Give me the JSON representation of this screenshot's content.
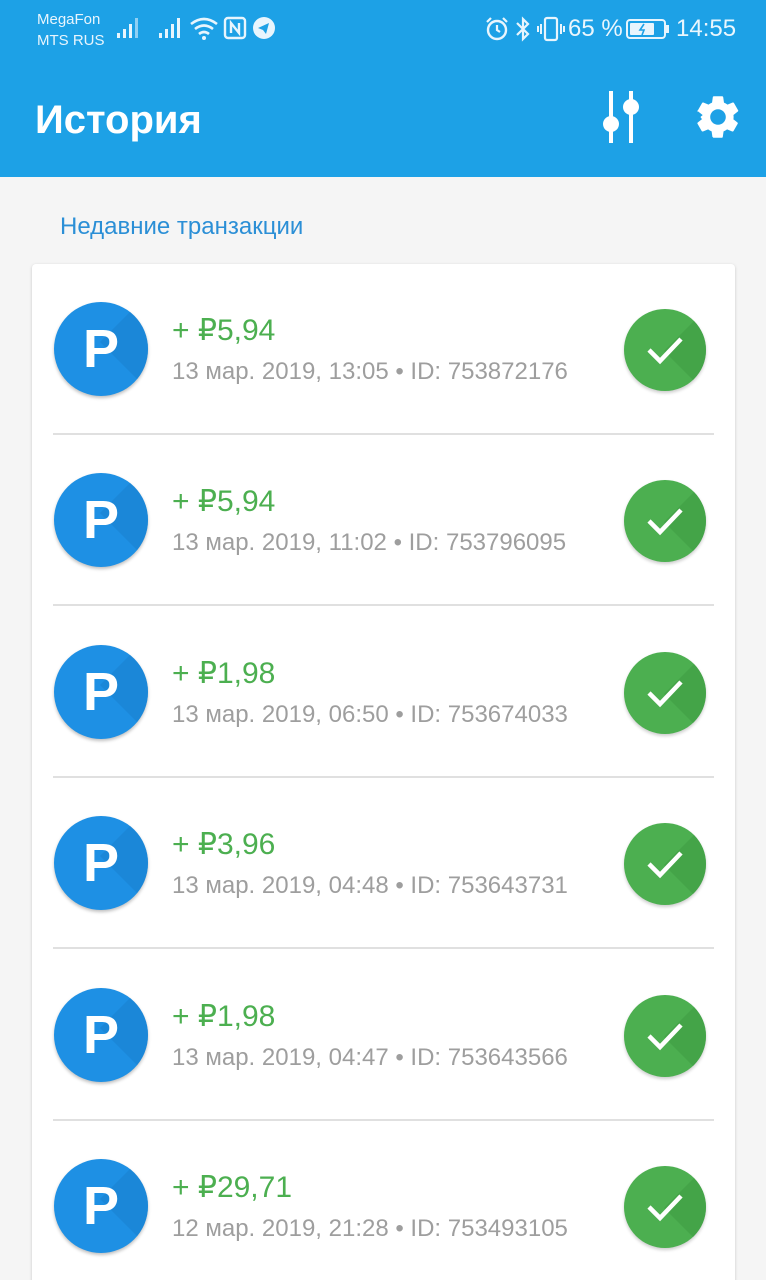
{
  "status_bar": {
    "carrier_1": "MegaFon",
    "carrier_2": "MTS RUS",
    "battery_percent": "65 %",
    "time": "14:55",
    "icons": [
      "signal-icon",
      "signal-icon",
      "wifi-icon",
      "nfc-icon",
      "telegram-icon",
      "alarm-icon",
      "bluetooth-icon",
      "vibrate-icon",
      "battery-icon"
    ]
  },
  "header": {
    "title": "История",
    "filter_icon": "filter-sliders-icon",
    "settings_icon": "gear-icon"
  },
  "section": {
    "label": "Недавние транзакции"
  },
  "transactions": [
    {
      "avatar_letter": "P",
      "amount": "+ ₽5,94",
      "meta": "13 мар. 2019, 13:05 • ID: 753872176",
      "status_icon": "check-icon"
    },
    {
      "avatar_letter": "P",
      "amount": "+ ₽5,94",
      "meta": "13 мар. 2019, 11:02 • ID: 753796095",
      "status_icon": "check-icon"
    },
    {
      "avatar_letter": "P",
      "amount": "+ ₽1,98",
      "meta": "13 мар. 2019, 06:50 • ID: 753674033",
      "status_icon": "check-icon"
    },
    {
      "avatar_letter": "P",
      "amount": "+ ₽3,96",
      "meta": "13 мар. 2019, 04:48 • ID: 753643731",
      "status_icon": "check-icon"
    },
    {
      "avatar_letter": "P",
      "amount": "+ ₽1,98",
      "meta": "13 мар. 2019, 04:47 • ID: 753643566",
      "status_icon": "check-icon"
    },
    {
      "avatar_letter": "P",
      "amount": "+ ₽29,71",
      "meta": "12 мар. 2019, 21:28 • ID: 753493105",
      "status_icon": "check-icon"
    }
  ],
  "colors": {
    "app_bar": "#1da1e6",
    "amount_positive": "#4caf50",
    "section_label": "#2b8fd6",
    "avatar": "#1e90e4",
    "status_ok": "#4caf50"
  }
}
